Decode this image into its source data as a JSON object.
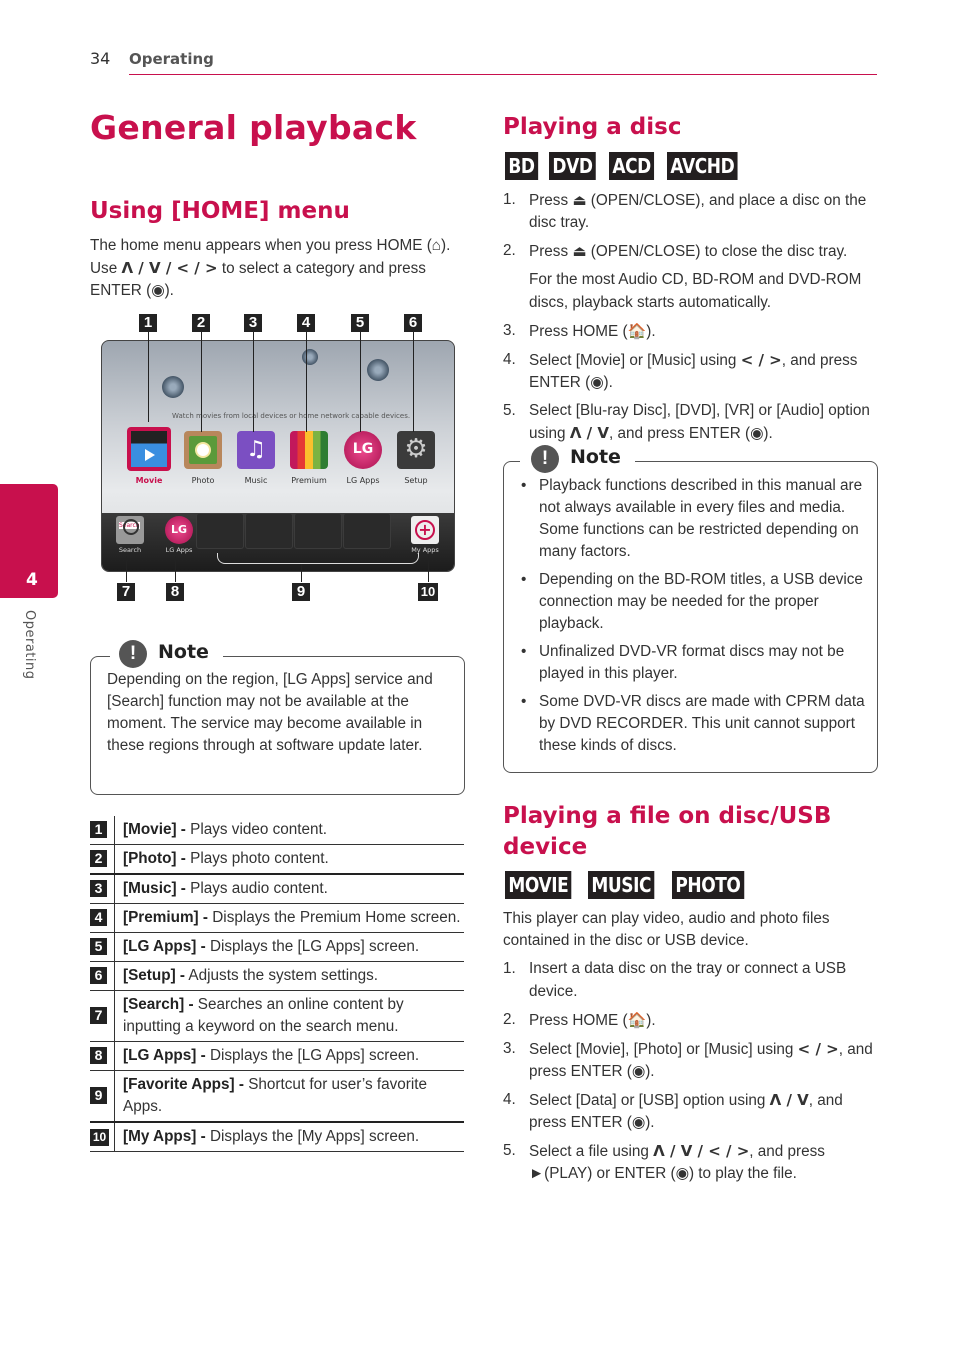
{
  "header": {
    "page_number": "34",
    "section": "Operating"
  },
  "side_tab": {
    "chapter_number": "4",
    "chapter_label": "Operating"
  },
  "title": "General playback",
  "home_menu": {
    "heading": "Using [HOME] menu",
    "intro_1": "The home menu appears when you press HOME (",
    "home_icon": "home-icon",
    "intro_2": "). Use ",
    "nav_keys": "Λ / V / < / >",
    "intro_3": " to select a category and press ENTER (",
    "enter_icon": "enter-icon",
    "intro_4": ")."
  },
  "screen": {
    "tagline": "Watch movies from local devices or home network capable devices.",
    "apps": [
      {
        "callout": "1",
        "label": "Movie",
        "selected": true
      },
      {
        "callout": "2",
        "label": "Photo"
      },
      {
        "callout": "3",
        "label": "Music"
      },
      {
        "callout": "4",
        "label": "Premium"
      },
      {
        "callout": "5",
        "label": "LG Apps"
      },
      {
        "callout": "6",
        "label": "Setup"
      }
    ],
    "dock": [
      {
        "callout": "7",
        "label": "Search"
      },
      {
        "callout": "8",
        "label": "LG Apps"
      },
      {
        "callout": "9",
        "label": ""
      },
      {
        "callout": "10",
        "label": "My Apps"
      }
    ],
    "lg_logo": "LG",
    "search_field_text": "Search"
  },
  "note1": {
    "label": "Note",
    "text": "Depending on the region, [LG Apps] service and [Search] function may not be available at the moment. The service may become available in these regions through at software update later."
  },
  "legend": [
    {
      "num": "1",
      "term": "[Movie] -",
      "desc": " Plays video content."
    },
    {
      "num": "2",
      "term": "[Photo] -",
      "desc": " Plays photo content."
    },
    {
      "num": "3",
      "term": "[Music] -",
      "desc": " Plays audio content."
    },
    {
      "num": "4",
      "term": "[Premium] -",
      "desc": " Displays the Premium Home screen."
    },
    {
      "num": "5",
      "term": "[LG Apps] -",
      "desc": " Displays the [LG Apps] screen."
    },
    {
      "num": "6",
      "term": "[Setup] -",
      "desc": " Adjusts the system settings."
    },
    {
      "num": "7",
      "term": "[Search] -",
      "desc": " Searches an online content by inputting a keyword on the search menu."
    },
    {
      "num": "8",
      "term": "[LG Apps] -",
      "desc": " Displays the [LG Apps] screen."
    },
    {
      "num": "9",
      "term": "[Favorite Apps] -",
      "desc": " Shortcut for user’s favorite Apps."
    },
    {
      "num": "10",
      "term": "[My Apps] -",
      "desc": " Displays the [My Apps] screen."
    }
  ],
  "disc": {
    "heading": "Playing a disc",
    "badges": [
      "BD",
      "DVD",
      "ACD",
      "AVCHD"
    ],
    "steps": [
      {
        "n": "1.",
        "a": "Press ",
        "sym": "⏏",
        "b": " (OPEN/CLOSE), and place a disc on the disc tray."
      },
      {
        "n": "2.",
        "a": "Press ",
        "sym": "⏏",
        "b": " (OPEN/CLOSE) to close the disc tray."
      },
      {
        "n": "",
        "a": "For the most Audio CD, BD-ROM and DVD-ROM discs, playback starts automatically.",
        "sym": "",
        "b": ""
      },
      {
        "n": "3.",
        "a": "Press HOME (",
        "sym": "🏠",
        "b": ")."
      },
      {
        "n": "4.",
        "a": "Select [Movie] or [Music] using ",
        "sym": "< / >",
        "b": ", and press ENTER (◉)."
      },
      {
        "n": "5.",
        "a": "Select [Blu-ray Disc], [DVD], [VR] or [Audio] option using ",
        "sym": "Λ / V",
        "b": ", and press ENTER (◉)."
      }
    ]
  },
  "note2": {
    "label": "Note",
    "bullets": [
      "Playback functions described in this manual are not always available in every files and media. Some functions can be restricted depending on many factors.",
      "Depending on the BD-ROM titles, a USB device connection may be needed for the proper playback.",
      "Unfinalized DVD-VR format discs may not be played in this player.",
      "Some DVD-VR discs are made with CPRM data by DVD RECORDER. This unit cannot support these kinds of discs."
    ]
  },
  "file": {
    "heading": "Playing a file on disc/USB device",
    "badges": [
      "MOVIE",
      "MUSIC",
      "PHOTO"
    ],
    "intro": "This player can play video, audio and photo files contained in the disc or USB device.",
    "steps": [
      {
        "n": "1.",
        "a": "Insert a data disc on the tray or connect a USB device.",
        "sym": "",
        "b": ""
      },
      {
        "n": "2.",
        "a": "Press HOME (",
        "sym": "🏠",
        "b": ")."
      },
      {
        "n": "3.",
        "a": "Select [Movie], [Photo] or [Music] using ",
        "sym": "< / >",
        "b": ", and press ENTER (◉)."
      },
      {
        "n": "4.",
        "a": "Select [Data] or [USB] option using ",
        "sym": "Λ / V",
        "b": ", and press ENTER (◉)."
      },
      {
        "n": "5.",
        "a": "Select a file using ",
        "sym": "Λ / V / < / >",
        "b": ", and press ►(PLAY) or ENTER (◉) to play the file."
      }
    ]
  },
  "colors": {
    "accent": "#c8104d",
    "badge": "#231f20",
    "text": "#333333"
  }
}
